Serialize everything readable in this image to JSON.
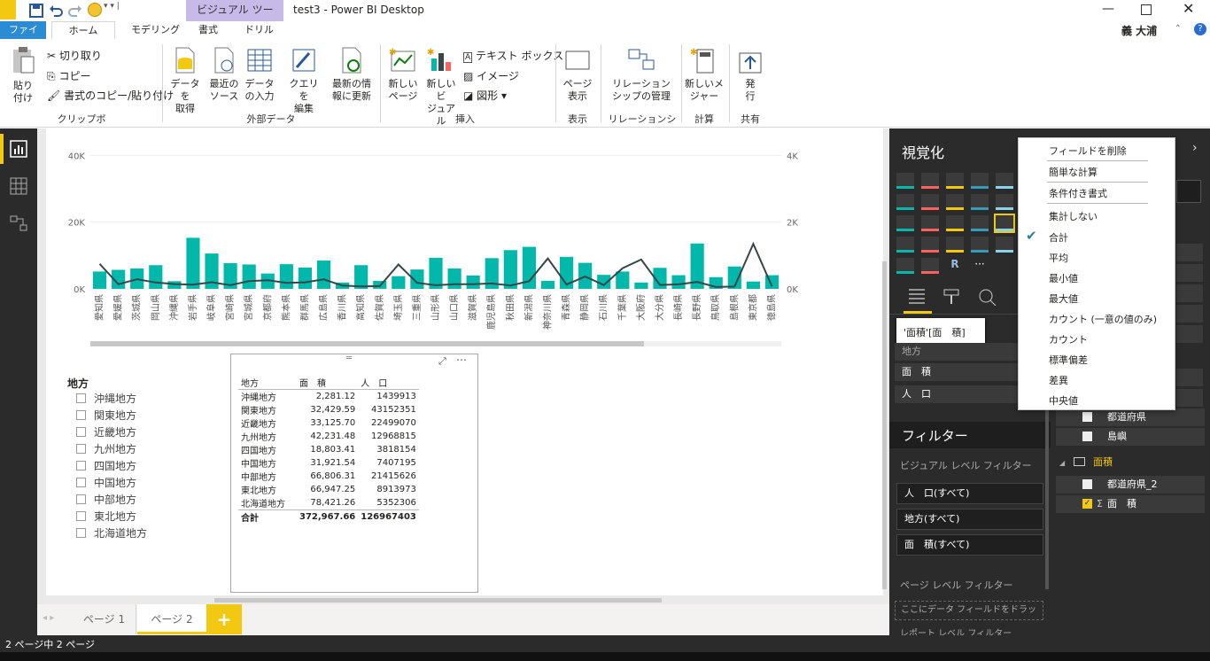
{
  "titlebar": {
    "visual_tools": "ビジュアル ツール",
    "title": "test3 - Power BI Desktop",
    "user": "義 大浦"
  },
  "menu": {
    "file": "ファイル",
    "home": "ホーム",
    "modeling": "モデリング",
    "format": "書式",
    "drill": "ドリル"
  },
  "ribbon": {
    "paste": "貼り\n付け",
    "cut": "切り取り",
    "copy": "コピー",
    "format_painter": "書式のコピー/貼り付け",
    "clipboard": "クリップボード",
    "get_data": "データを\n取得",
    "recent_sources": "最近の\nソース",
    "enter_data": "データ\nの入力",
    "edit_queries": "クエリを\n編集",
    "refresh": "最新の情\n報に更新",
    "external_data": "外部データ",
    "new_page": "新しい\nページ",
    "new_visual": "新しいビ\nジュアル",
    "textbox": "テキスト ボックス",
    "image": "イメージ",
    "shapes": "図形",
    "insert": "挿入",
    "page_view": "ページ\n表示",
    "view": "表示",
    "manage_rel": "リレーション\nシップの管理",
    "relationships": "リレーションシップ",
    "new_measure": "新しいメ\nジャー",
    "calc": "計算",
    "publish": "発\n行",
    "share": "共有"
  },
  "chart_data": {
    "type": "bar",
    "categories": [
      "愛知県",
      "愛媛県",
      "茨城県",
      "岡山県",
      "沖縄県",
      "岩手県",
      "岐阜県",
      "宮崎県",
      "宮城県",
      "京都府",
      "熊本県",
      "群馬県",
      "広島県",
      "香川県",
      "高知県",
      "佐賀県",
      "埼玉県",
      "三重県",
      "山形県",
      "山口県",
      "滋賀県",
      "鹿児島県",
      "秋田県",
      "新潟県",
      "神奈川県",
      "青森県",
      "静岡県",
      "石川県",
      "千葉県",
      "大阪府",
      "大分県",
      "長崎県",
      "長野県",
      "鳥取県",
      "島根県",
      "東京都",
      "徳島県"
    ],
    "series": [
      {
        "name": "面積",
        "axis": "left",
        "values": [
          5200,
          5700,
          6100,
          7100,
          2300,
          15300,
          10600,
          7700,
          7300,
          4600,
          7400,
          6400,
          8500,
          1900,
          7100,
          2400,
          3800,
          5800,
          9300,
          6100,
          4000,
          9200,
          11600,
          12600,
          2400,
          9600,
          7800,
          4200,
          5200,
          1900,
          6300,
          4100,
          13600,
          3500,
          6700,
          2200,
          4100
        ]
      },
      {
        "name": "人口",
        "axis": "right",
        "values": [
          750,
          139,
          290,
          190,
          144,
          126,
          200,
          109,
          233,
          260,
          178,
          196,
          284,
          97,
          72,
          83,
          730,
          180,
          110,
          138,
          141,
          163,
          102,
          230,
          910,
          129,
          370,
          115,
          620,
          880,
          116,
          135,
          208,
          57,
          69,
          1350,
          75
        ]
      }
    ],
    "left_ticks": [
      "0K",
      "20K",
      "40K"
    ],
    "right_ticks": [
      "0K",
      "2K",
      "4K"
    ],
    "ylim_left": [
      0,
      47000
    ],
    "ylim_right": [
      0,
      4700
    ],
    "bar_color": "#01b8aa",
    "line_color": "#374649"
  },
  "slicer": {
    "title": "地方",
    "items": [
      "沖縄地方",
      "関東地方",
      "近畿地方",
      "九州地方",
      "四国地方",
      "中国地方",
      "中部地方",
      "東北地方",
      "北海道地方"
    ]
  },
  "table": {
    "headers": [
      "地方",
      "面　積",
      "人　口"
    ],
    "rows": [
      [
        "沖縄地方",
        "2,281.12",
        "1439913"
      ],
      [
        "関東地方",
        "32,429.59",
        "43152351"
      ],
      [
        "近畿地方",
        "33,125.70",
        "22499070"
      ],
      [
        "九州地方",
        "42,231.48",
        "12968815"
      ],
      [
        "四国地方",
        "18,803.41",
        "3818154"
      ],
      [
        "中国地方",
        "31,921.54",
        "7407195"
      ],
      [
        "中部地方",
        "66,806.31",
        "21415626"
      ],
      [
        "東北地方",
        "66,947.25",
        "8913973"
      ],
      [
        "北海道地方",
        "78,421.26",
        "5352306"
      ]
    ],
    "total": [
      "合計",
      "372,967.66",
      "126967403"
    ]
  },
  "pages": {
    "page1": "ページ 1",
    "page2": "ページ 2",
    "add": "+"
  },
  "viz_pane": {
    "title": "視覚化",
    "tooltip": "'面積'[面　積]",
    "field1": "地方",
    "field2": "面　積",
    "field3": "人　口",
    "filters_title": "フィルター",
    "visual_level": "ビジュアル レベル フィルター",
    "filter1": "人　口(すべて)",
    "filter2": "地方(すべて)",
    "filter3": "面　積(すべて)",
    "page_level": "ページ レベル フィルター",
    "drop_here": "ここにデータ フィールドをドラッグ...",
    "report_level": "レポート レベル フィルター"
  },
  "context_menu": {
    "items": [
      "フィールドを削除",
      "簡単な計算",
      "条件付き書式",
      "集計しない",
      "合計",
      "平均",
      "最小値",
      "最大値",
      "カウント (一意の値のみ)",
      "カウント",
      "標準偏差",
      "差異",
      "中央値"
    ],
    "checked": "合計"
  },
  "fields_pane": {
    "f_todofuken": "都道府県",
    "f_shima": "島嶼",
    "t_menseki": "面積",
    "f_todofuken2": "都道府県_2",
    "f_menseki": "面　積"
  },
  "status": {
    "text": "2 ページ中 2 ページ"
  },
  "colors": {
    "accent": "#f2c811",
    "visual_tools_tab": "#c7b9e8",
    "file_tab": "#2b8bd3",
    "pane_bg": "#2b2b2b"
  }
}
